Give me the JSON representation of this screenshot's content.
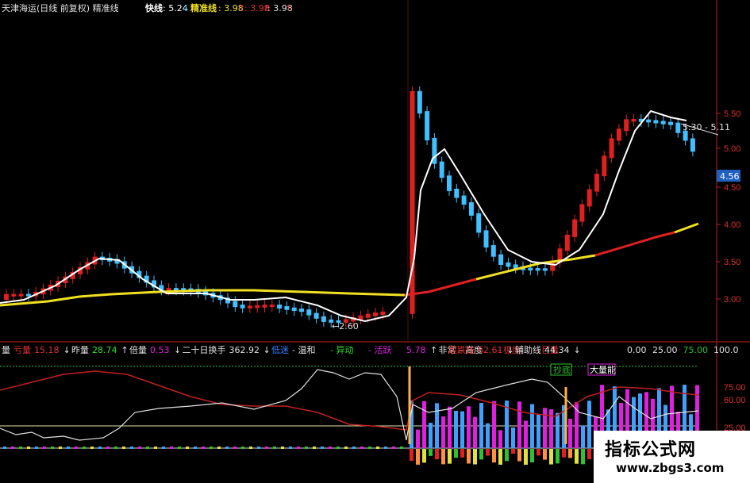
{
  "top_bar": {
    "stock_name": "天津海运(日线 前复权) 精准线",
    "fast_label": "快线",
    "fast_value": ": 5.24",
    "fast_arrow": "↓",
    "precise_label": "精准线",
    "precise_value": ": 3.98",
    "precise_up_arrow": "↑",
    "red_value": ": 3.98",
    "red_arrow": "↑",
    "white_value": ": 3.98",
    "white_arrow": "↑"
  },
  "price_axis": {
    "ticks": [
      "5.50",
      "5.00",
      "4.50",
      "4.00",
      "3.50",
      "3.00"
    ],
    "current_price": "4.56"
  },
  "annotations": {
    "low_label": "←2.60",
    "high_label": "5.30 - 5.11"
  },
  "indicator_bar": {
    "items": [
      {
        "text": "量",
        "color": "#e0e0e0"
      },
      {
        "text": "亏量",
        "color": "#e03030"
      },
      {
        "text": "15.18",
        "color": "#e03030"
      },
      {
        "text": "↓",
        "color": "#e0e0e0"
      },
      {
        "text": "昨量",
        "color": "#e0e0e0"
      },
      {
        "text": "28.74",
        "color": "#30e030"
      },
      {
        "text": "↑",
        "color": "#e0e0e0"
      },
      {
        "text": "倍量",
        "color": "#e0e0e0"
      },
      {
        "text": "0.53",
        "color": "#e020e0"
      },
      {
        "text": "↓",
        "color": "#e0e0e0"
      },
      {
        "text": "二十日换手",
        "color": "#e0e0e0"
      },
      {
        "text": "362.92",
        "color": "#e0e0e0"
      },
      {
        "text": "↓",
        "color": "#e0e0e0"
      },
      {
        "text": "低迷",
        "color": "#3080ff"
      },
      {
        "text": "- 温和",
        "color": "#e0e0e0"
      },
      {
        "text": "- 异动",
        "color": "#30e030"
      },
      {
        "text": "- 活跃",
        "color": "#e020e0"
      },
      {
        "text": "5.78",
        "color": "#e020e0"
      },
      {
        "text": "↑",
        "color": "#e0e0e0"
      },
      {
        "text": "非常",
        "color": "#e0e0e0"
      },
      {
        "text": "- 高度",
        "color": "#e0e0e0"
      },
      {
        "text": "- 极度",
        "color": "#e03030"
      },
      {
        "text": "- 巨量",
        "color": "#e03030"
      }
    ],
    "right_items": [
      {
        "text": "超跌线",
        "color": "#e03030"
      },
      {
        "text": "62.61",
        "color": "#e03030"
      },
      {
        "text": "↓",
        "color": "#e0e0e0"
      },
      {
        "text": "辅助线",
        "color": "#e0e0e0"
      },
      {
        "text": "44.34",
        "color": "#e0e0e0"
      },
      {
        "text": "↓",
        "color": "#e0e0e0"
      }
    ],
    "scale_items": [
      {
        "text": "0.00",
        "color": "#e0e0e0"
      },
      {
        "text": "25.00",
        "color": "#e0e0e0"
      },
      {
        "text": "75.00",
        "color": "#30c030"
      },
      {
        "text": "100.0",
        "color": "#e0e0e0"
      }
    ]
  },
  "osc_axis": {
    "ticks": [
      "75.00",
      "60.00",
      "25.00"
    ]
  },
  "signals": {
    "bottom_label": "抄底",
    "big_volume_label": "大量能"
  },
  "watermark": {
    "title": "指标公式网",
    "url": "www.zbgs3.com"
  },
  "colors": {
    "up_candle": "#e02020",
    "down_candle": "#40c0ff",
    "fast_line": "#ffffff",
    "precise_line_up": "#f0e020",
    "precise_line_down": "#e02020",
    "axis": "#c02020"
  }
}
